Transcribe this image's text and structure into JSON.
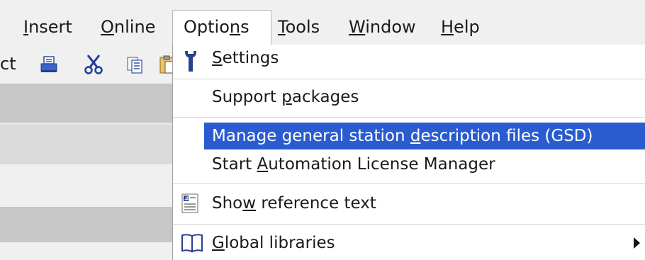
{
  "menubar": {
    "items": [
      {
        "prefix": "",
        "accel": "I",
        "suffix": "nsert"
      },
      {
        "prefix": "",
        "accel": "O",
        "suffix": "nline"
      },
      {
        "prefix": "Optio",
        "accel": "n",
        "suffix": "s"
      },
      {
        "prefix": "",
        "accel": "T",
        "suffix": "ools"
      },
      {
        "prefix": "",
        "accel": "W",
        "suffix": "indow"
      },
      {
        "prefix": "",
        "accel": "H",
        "suffix": "elp"
      }
    ]
  },
  "toolbar": {
    "partial_text": "ct",
    "icons": [
      "printer-icon",
      "scissors-icon",
      "copy-icon",
      "paste-icon"
    ]
  },
  "options_menu": {
    "items": [
      {
        "prefix": "",
        "accel": "S",
        "suffix": "ettings",
        "icon": "wrench-icon"
      },
      {
        "prefix": "Support ",
        "accel": "p",
        "suffix": "ackages"
      },
      {
        "prefix": "Manage general station ",
        "accel": "d",
        "suffix": "escription files (GSD)",
        "highlighted": true
      },
      {
        "prefix": "Start ",
        "accel": "A",
        "suffix": "utomation License Manager"
      },
      {
        "prefix": "Sho",
        "accel": "w",
        "suffix": " reference text",
        "icon": "reference-text-icon"
      },
      {
        "prefix": "",
        "accel": "G",
        "suffix": "lobal libraries",
        "icon": "book-icon",
        "has_submenu": true
      }
    ]
  },
  "colors": {
    "highlight": "#2a5cd0",
    "menubar_bg": "#f0f0f0"
  }
}
